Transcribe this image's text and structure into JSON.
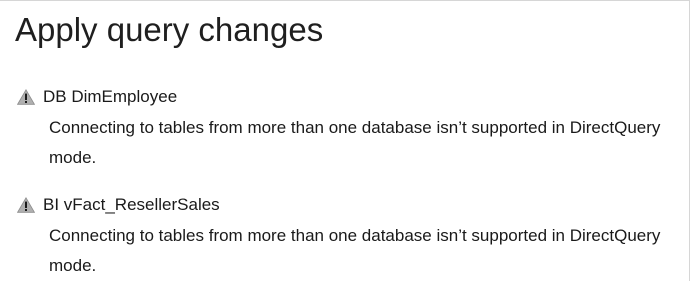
{
  "dialog": {
    "title": "Apply query changes"
  },
  "colors": {
    "warning_icon_fill": "#b0b0b0",
    "warning_icon_mark": "#1a1a1a",
    "border": "#d6d6d6"
  },
  "items": [
    {
      "icon": "warning-icon",
      "name": "DB DimEmployee",
      "message": "Connecting to tables from more than one database isn’t supported in DirectQuery mode."
    },
    {
      "icon": "warning-icon",
      "name": "BI vFact_ResellerSales",
      "message": "Connecting to tables from more than one database isn’t supported in DirectQuery mode."
    }
  ]
}
